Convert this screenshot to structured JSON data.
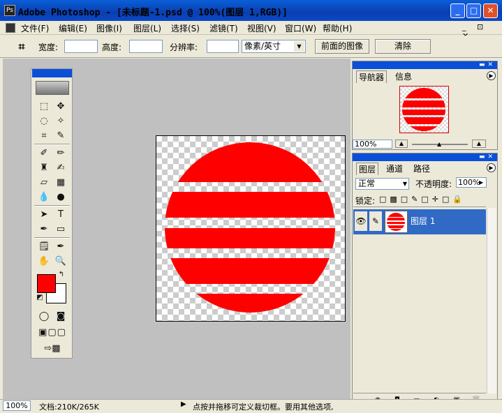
{
  "app": {
    "title": "Adobe Photoshop - [未标题-1.psd @ 100%(图层 1,RGB)]",
    "icon": "photoshop-icon"
  },
  "window_buttons": {
    "minimize": "_",
    "maximize": "□",
    "close": "✕"
  },
  "menu": [
    "文件(F)",
    "编辑(E)",
    "图像(I)",
    "图层(L)",
    "选择(S)",
    "滤镜(T)",
    "视图(V)",
    "窗口(W)",
    "帮助(H)"
  ],
  "mdi_controls": "_ ⊡ ✕",
  "options_bar": {
    "width_label": "宽度:",
    "height_label": "高度:",
    "resolution_label": "分辨率:",
    "unit_value": "像素/英寸",
    "front_image_button": "前面的图像",
    "clear_button": "清除",
    "tool_icon": "crop-icon"
  },
  "canvas": {
    "artwork": "red-striped-circle",
    "color": "#ff0000"
  },
  "colors": {
    "foreground": "#ff0000",
    "background": "#ffffff"
  },
  "navigator": {
    "tabs": [
      "导航器",
      "信息"
    ],
    "zoom": "100%"
  },
  "layers_panel": {
    "tabs": [
      "图层",
      "通道",
      "路径"
    ],
    "blend_mode": "正常",
    "opacity_label": "不透明度:",
    "opacity_value": "100%",
    "lock_label": "锁定:",
    "layer_name": "图层 1"
  },
  "status": {
    "zoom": "100%",
    "doc": "文档:210K/265K",
    "hint": "点按并拖移可定义裁切框。要用其他选项,"
  }
}
